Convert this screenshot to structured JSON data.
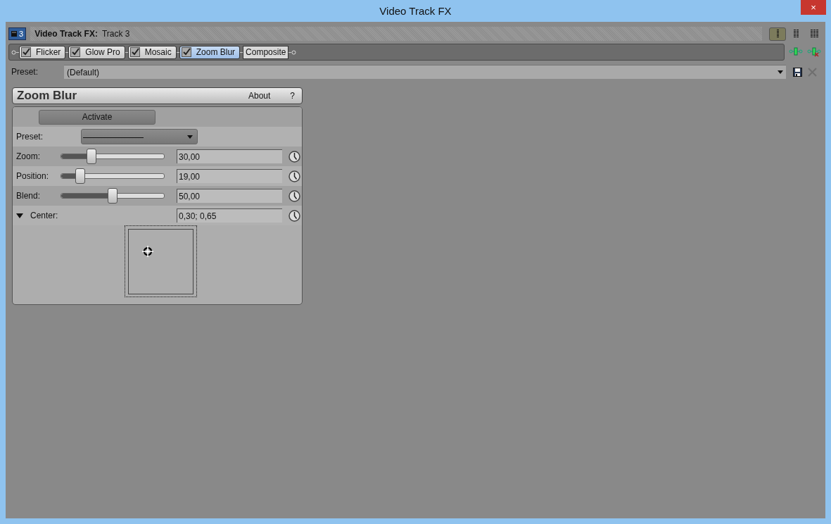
{
  "window": {
    "title": "Video Track FX",
    "close": "×"
  },
  "header": {
    "track_number": "3",
    "label": "Video Track FX:",
    "track": "Track 3"
  },
  "view_modes": [
    {
      "selected": true
    },
    {
      "selected": false
    },
    {
      "selected": false
    }
  ],
  "chain": [
    {
      "kind": "plugin",
      "name": "Flicker",
      "enabled": true,
      "selected": false
    },
    {
      "kind": "plugin",
      "name": "Glow Pro",
      "enabled": true,
      "selected": false
    },
    {
      "kind": "plugin",
      "name": "Mosaic",
      "enabled": true,
      "selected": false
    },
    {
      "kind": "plugin",
      "name": "Zoom Blur",
      "enabled": true,
      "selected": true
    },
    {
      "kind": "compositor",
      "name": "Composite",
      "selected": false
    }
  ],
  "preset": {
    "label": "Preset:",
    "value": "(Default)"
  },
  "plugin": {
    "title": "Zoom Blur",
    "about": "About",
    "help": "?",
    "activate": "Activate",
    "preset_label": "Preset:",
    "params": [
      {
        "kind": "slider",
        "label": "Zoom:",
        "level": 0.3,
        "value": "30,00"
      },
      {
        "kind": "slider",
        "label": "Position:",
        "level": 0.19,
        "value": "19,00"
      },
      {
        "kind": "slider",
        "label": "Blend:",
        "level": 0.5,
        "value": "50,00"
      },
      {
        "kind": "point",
        "label": "Center:",
        "value": "0,30; 0,65",
        "expanded": true
      }
    ]
  }
}
